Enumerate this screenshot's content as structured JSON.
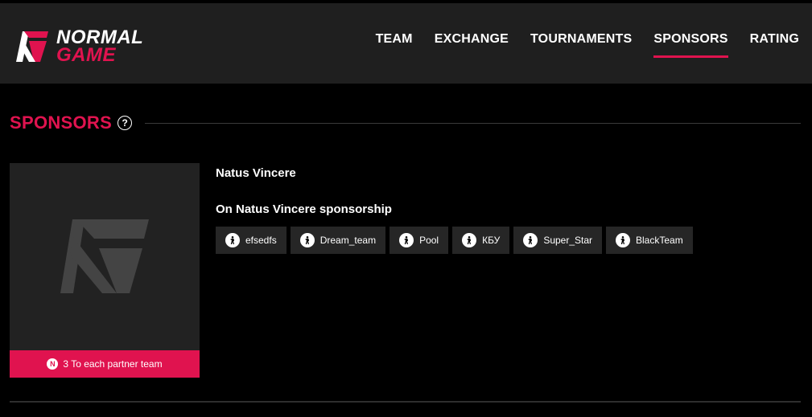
{
  "brand": {
    "line1": "NORMAL",
    "line2": "GAME",
    "accent": "#e0134f"
  },
  "nav": {
    "items": [
      {
        "label": "TEAM",
        "active": false
      },
      {
        "label": "EXCHANGE",
        "active": false
      },
      {
        "label": "TOURNAMENTS",
        "active": false
      },
      {
        "label": "SPONSORS",
        "active": true
      },
      {
        "label": "RATING",
        "active": false
      }
    ]
  },
  "section": {
    "title": "SPONSORS",
    "help_icon": "question-circle-icon"
  },
  "sponsor": {
    "name": "Natus Vincere",
    "sponsorship_title": "On Natus Vincere sponsorship",
    "reward_text": "3 To each partner team",
    "reward_icon": "coin-icon",
    "teams": [
      {
        "label": "efsedfs",
        "icon": "cs-player-icon"
      },
      {
        "label": "Dream_team",
        "icon": "cs-player-icon"
      },
      {
        "label": "Pool",
        "icon": "cs-player-icon"
      },
      {
        "label": "КБУ",
        "icon": "cs-player-icon"
      },
      {
        "label": "Super_Star",
        "icon": "cs-player-icon"
      },
      {
        "label": "BlackTeam",
        "icon": "cs-player-icon"
      }
    ]
  }
}
